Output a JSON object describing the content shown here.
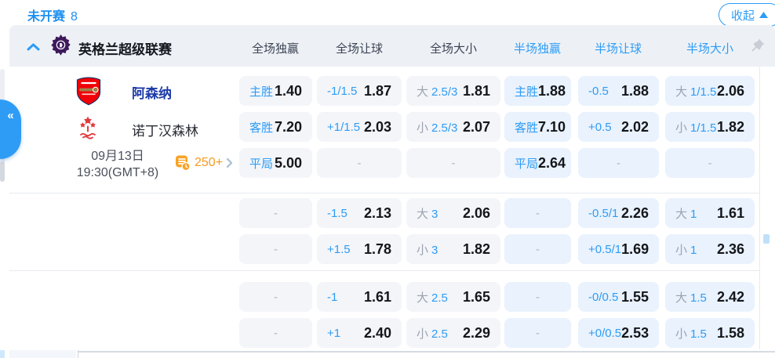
{
  "colors": {
    "accent_blue": "#2e9cf5",
    "full_cell_bg": "#f3f5f9",
    "half_cell_bg": "#e9f2fd",
    "orange": "#f59b22",
    "premier_league_purple": "#3d195b",
    "arsenal_red": "#ef0107",
    "forest_red": "#e03a3e"
  },
  "icons": {
    "collapse_triangle": "triangle-up",
    "band_chevron": "chevron-up",
    "sidebar_collapse": "«",
    "markets_arrow": "chevron-right",
    "pin": "pushpin",
    "league_logo": "premier-league-lion",
    "home_crest": "arsenal-crest",
    "away_crest": "nottingham-forest-crest",
    "markets_icon": "odds-list-clock"
  },
  "topbar": {
    "status": "未开赛",
    "count": "8",
    "collapse_label": "收起"
  },
  "header": {
    "league": "英格兰超级联赛",
    "columns": [
      {
        "label": "全场独赢",
        "scope": "full"
      },
      {
        "label": "全场让球",
        "scope": "full"
      },
      {
        "label": "全场大小",
        "scope": "full"
      },
      {
        "label": "半场独赢",
        "scope": "half"
      },
      {
        "label": "半场让球",
        "scope": "half"
      },
      {
        "label": "半场大小",
        "scope": "half"
      }
    ]
  },
  "match": {
    "home_team": "阿森纳",
    "away_team": "诺丁汉森林",
    "date": "09月13日",
    "time": "19:30(GMT+8)",
    "markets_count": "250+"
  },
  "odds": {
    "groups": [
      {
        "rows": [
          [
            {
              "label": "主胜",
              "value": "1.40"
            },
            {
              "label": "-1/1.5",
              "value": "1.87"
            },
            {
              "prefix": "大",
              "label": "2.5/3",
              "value": "1.81"
            },
            {
              "label": "主胜",
              "value": "1.88"
            },
            {
              "label": "-0.5",
              "value": "1.88"
            },
            {
              "prefix": "大",
              "label": "1/1.5",
              "value": "2.06"
            }
          ],
          [
            {
              "label": "客胜",
              "value": "7.20"
            },
            {
              "label": "+1/1.5",
              "value": "2.03"
            },
            {
              "prefix": "小",
              "label": "2.5/3",
              "value": "2.07"
            },
            {
              "label": "客胜",
              "value": "7.10"
            },
            {
              "label": "+0.5",
              "value": "2.02"
            },
            {
              "prefix": "小",
              "label": "1/1.5",
              "value": "1.82"
            }
          ],
          [
            {
              "label": "平局",
              "value": "5.00"
            },
            {
              "dash": "-"
            },
            {
              "dash": "-"
            },
            {
              "label": "平局",
              "value": "2.64"
            },
            {
              "dash": "-"
            },
            {
              "dash": "-"
            }
          ]
        ]
      },
      {
        "rows": [
          [
            {
              "dash": "-"
            },
            {
              "label": "-1.5",
              "value": "2.13"
            },
            {
              "prefix": "大",
              "label": "3",
              "value": "2.06"
            },
            {
              "dash": "-"
            },
            {
              "label": "-0.5/1",
              "value": "2.26"
            },
            {
              "prefix": "大",
              "label": "1",
              "value": "1.61"
            }
          ],
          [
            {
              "dash": "-"
            },
            {
              "label": "+1.5",
              "value": "1.78"
            },
            {
              "prefix": "小",
              "label": "3",
              "value": "1.82"
            },
            {
              "dash": "-"
            },
            {
              "label": "+0.5/1",
              "value": "1.69"
            },
            {
              "prefix": "小",
              "label": "1",
              "value": "2.36"
            }
          ]
        ]
      },
      {
        "rows": [
          [
            {
              "dash": "-"
            },
            {
              "label": "-1",
              "value": "1.61"
            },
            {
              "prefix": "大",
              "label": "2.5",
              "value": "1.65"
            },
            {
              "dash": "-"
            },
            {
              "label": "-0/0.5",
              "value": "1.55"
            },
            {
              "prefix": "大",
              "label": "1.5",
              "value": "2.42"
            }
          ],
          [
            {
              "dash": "-"
            },
            {
              "label": "+1",
              "value": "2.40"
            },
            {
              "prefix": "小",
              "label": "2.5",
              "value": "2.29"
            },
            {
              "dash": "-"
            },
            {
              "label": "+0/0.5",
              "value": "2.53"
            },
            {
              "prefix": "小",
              "label": "1.5",
              "value": "1.58"
            }
          ]
        ]
      }
    ]
  }
}
